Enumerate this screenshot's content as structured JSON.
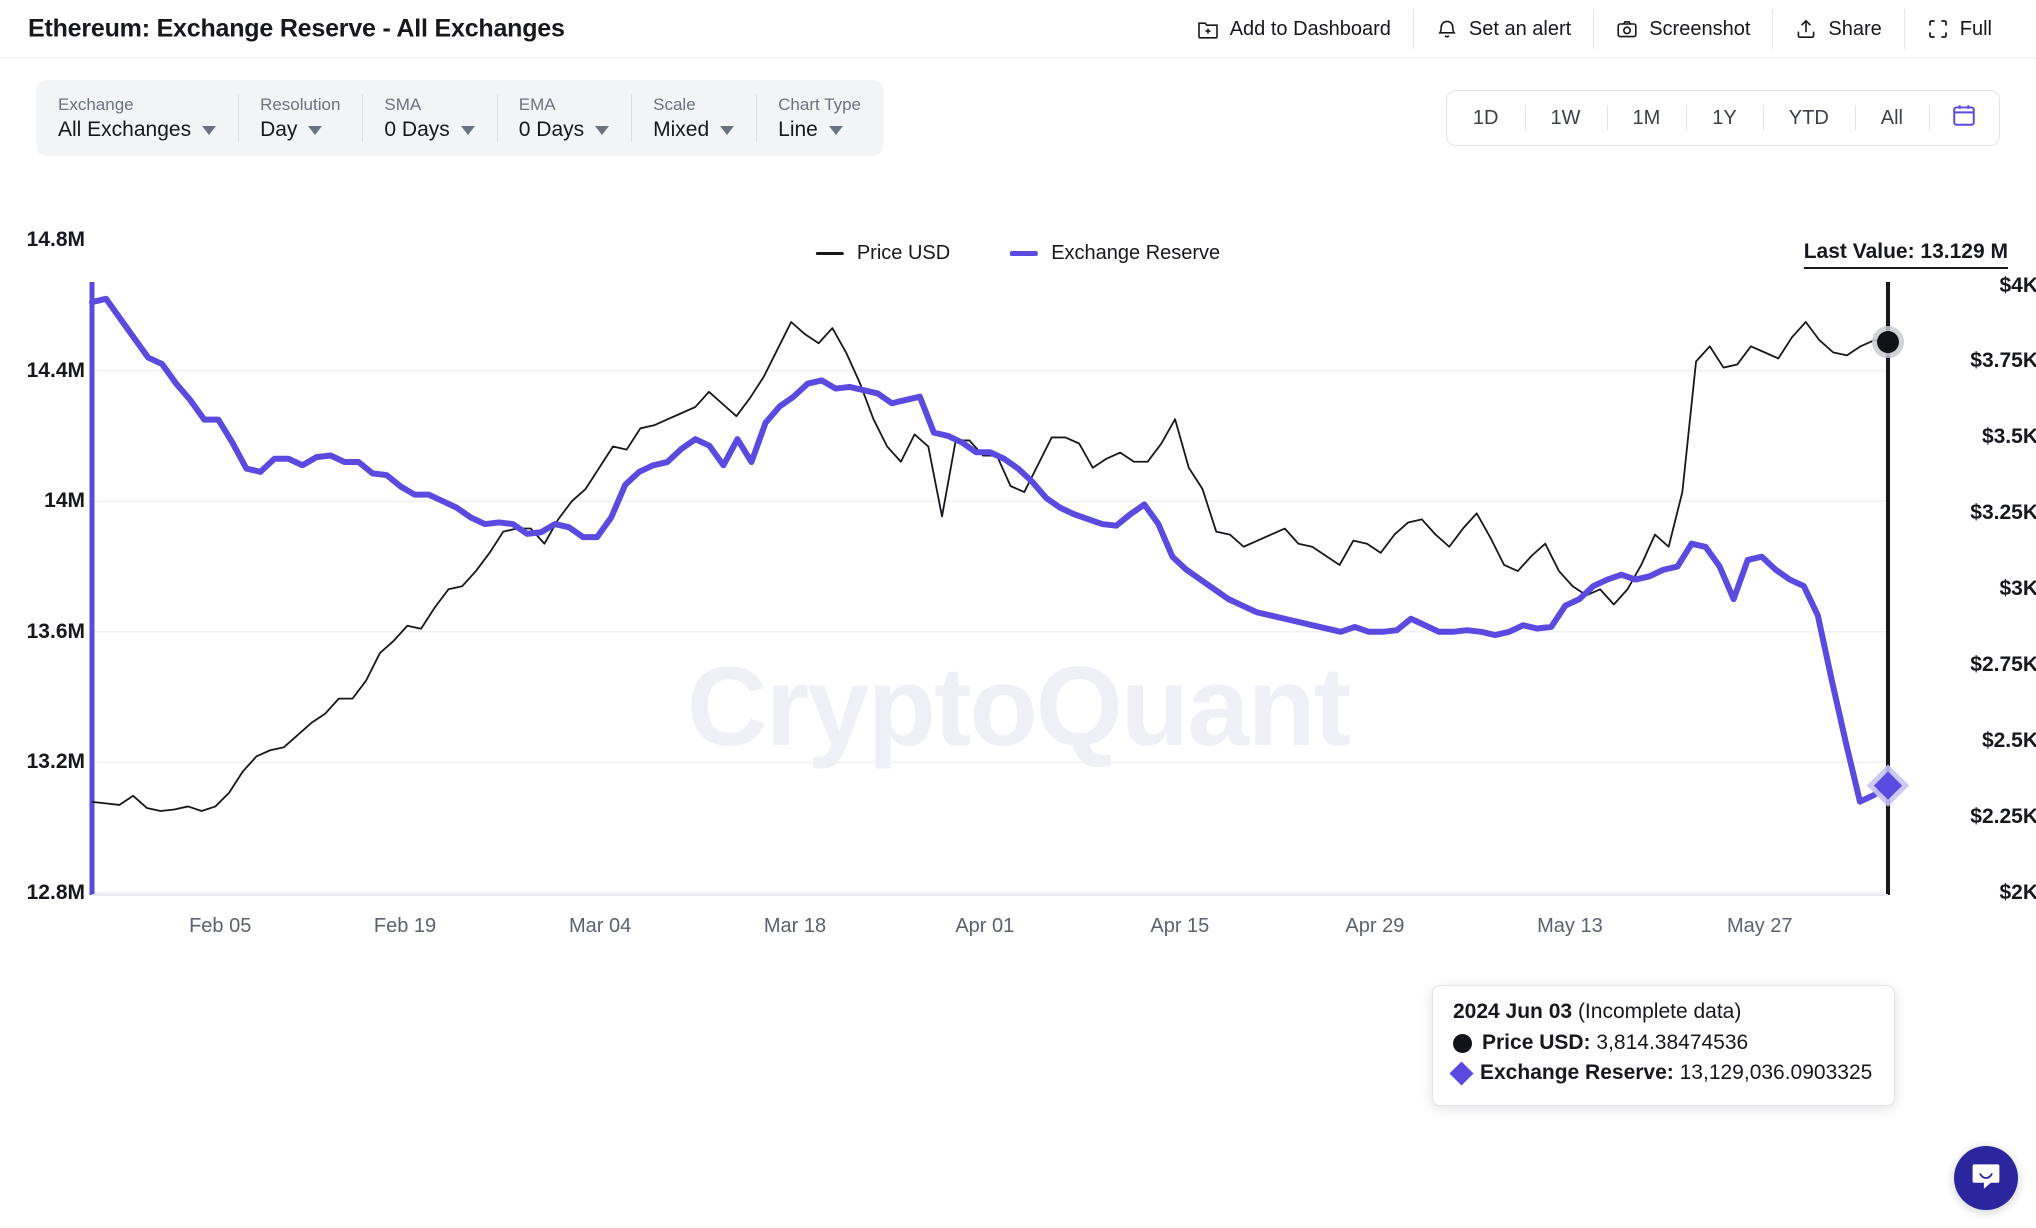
{
  "header": {
    "title": "Ethereum: Exchange Reserve - All Exchanges",
    "actions": [
      {
        "icon": "add-to-dashboard-icon",
        "label": "Add to Dashboard"
      },
      {
        "icon": "bell-icon",
        "label": "Set an alert"
      },
      {
        "icon": "camera-icon",
        "label": "Screenshot"
      },
      {
        "icon": "share-icon",
        "label": "Share"
      },
      {
        "icon": "fullscreen-icon",
        "label": "Full"
      }
    ]
  },
  "controls": [
    {
      "name": "exchange",
      "label": "Exchange",
      "value": "All Exchanges"
    },
    {
      "name": "resolution",
      "label": "Resolution",
      "value": "Day"
    },
    {
      "name": "sma",
      "label": "SMA",
      "value": "0 Days"
    },
    {
      "name": "ema",
      "label": "EMA",
      "value": "0 Days"
    },
    {
      "name": "scale",
      "label": "Scale",
      "value": "Mixed"
    },
    {
      "name": "chart-type",
      "label": "Chart Type",
      "value": "Line"
    }
  ],
  "ranges": [
    "1D",
    "1W",
    "1M",
    "1Y",
    "YTD",
    "All"
  ],
  "calendar_icon": "calendar-icon",
  "legend": [
    {
      "label": "Price USD",
      "color": "#16181d"
    },
    {
      "label": "Exchange Reserve",
      "color": "#5b4ae0"
    }
  ],
  "last_value": "Last Value: 13.129 M",
  "watermark": "CryptoQuant",
  "tooltip": {
    "date": "2024 Jun 03",
    "note": "(Incomplete data)",
    "rows": [
      {
        "marker": "circle",
        "name": "Price USD",
        "value": "3,814.38474536"
      },
      {
        "marker": "diamond",
        "name": "Exchange Reserve",
        "value": "13,129,036.0903325"
      }
    ]
  },
  "chat": {
    "icon": "chat-icon"
  },
  "chart_data": {
    "type": "line",
    "title": "Ethereum: Exchange Reserve - All Exchanges",
    "xlabel": "",
    "ylabel": "Exchange Reserve",
    "y2label": "Price USD",
    "grid": true,
    "legend_position": "top-center",
    "x_tick_labels": [
      "Feb 05",
      "Feb 19",
      "Mar 04",
      "Mar 18",
      "Apr 01",
      "Apr 15",
      "Apr 29",
      "May 13",
      "May 27"
    ],
    "x_tick_positions": [
      0.0714,
      0.1743,
      0.2829,
      0.3914,
      0.4971,
      0.6057,
      0.7143,
      0.8229,
      0.9286
    ],
    "y_left_ticks": [
      "12.8M",
      "13.2M",
      "13.6M",
      "14M",
      "14.4M",
      "14.8M"
    ],
    "y_left_values": [
      12800000,
      13200000,
      13600000,
      14000000,
      14400000,
      14800000
    ],
    "ylim": [
      12800000,
      14800000
    ],
    "y_right_ticks": [
      "$2.25K",
      "$2.5K",
      "$2.75K",
      "$3K",
      "$3.25K",
      "$3.5K",
      "$3.75K",
      "$4K"
    ],
    "y_right_values": [
      2250,
      2500,
      2750,
      3000,
      3250,
      3500,
      3750,
      4000
    ],
    "y2lim": [
      2000,
      4150
    ],
    "series": [
      {
        "name": "Exchange Reserve",
        "color": "#5b4ae0",
        "axis": "left",
        "unit": "ETH",
        "values": [
          14610000,
          14620000,
          14560000,
          14500000,
          14440000,
          14420000,
          14360000,
          14310000,
          14250000,
          14250000,
          14180000,
          14100000,
          14090000,
          14130000,
          14130000,
          14110000,
          14135000,
          14140000,
          14120000,
          14120000,
          14085000,
          14080000,
          14045000,
          14020000,
          14020000,
          14000000,
          13980000,
          13950000,
          13930000,
          13935000,
          13930000,
          13900000,
          13905000,
          13930000,
          13920000,
          13890000,
          13890000,
          13950000,
          14050000,
          14090000,
          14110000,
          14120000,
          14160000,
          14190000,
          14170000,
          14110000,
          14190000,
          14120000,
          14240000,
          14290000,
          14320000,
          14360000,
          14370000,
          14345000,
          14350000,
          14340000,
          14330000,
          14300000,
          14310000,
          14320000,
          14210000,
          14200000,
          14180000,
          14150000,
          14150000,
          14130000,
          14100000,
          14060000,
          14010000,
          13980000,
          13960000,
          13945000,
          13930000,
          13925000,
          13960000,
          13990000,
          13930000,
          13830000,
          13790000,
          13760000,
          13730000,
          13700000,
          13680000,
          13660000,
          13650000,
          13640000,
          13630000,
          13620000,
          13610000,
          13600000,
          13615000,
          13600000,
          13600000,
          13605000,
          13640000,
          13620000,
          13600000,
          13600000,
          13605000,
          13600000,
          13590000,
          13600000,
          13620000,
          13610000,
          13615000,
          13680000,
          13700000,
          13740000,
          13760000,
          13775000,
          13760000,
          13770000,
          13790000,
          13800000,
          13870000,
          13860000,
          13800000,
          13700000,
          13820000,
          13830000,
          13790000,
          13760000,
          13740000,
          13650000,
          13450000,
          13260000,
          13080000,
          13100000,
          13129036
        ]
      },
      {
        "name": "Price USD",
        "color": "#16181d",
        "axis": "right",
        "unit": "USD",
        "values": [
          2300,
          2295,
          2290,
          2320,
          2280,
          2270,
          2275,
          2285,
          2270,
          2285,
          2330,
          2400,
          2450,
          2470,
          2480,
          2520,
          2560,
          2590,
          2640,
          2640,
          2700,
          2790,
          2830,
          2880,
          2870,
          2940,
          3000,
          3010,
          3060,
          3120,
          3190,
          3200,
          3200,
          3150,
          3230,
          3290,
          3330,
          3400,
          3470,
          3460,
          3530,
          3540,
          3560,
          3580,
          3600,
          3650,
          3610,
          3570,
          3630,
          3700,
          3790,
          3880,
          3840,
          3810,
          3860,
          3780,
          3680,
          3560,
          3470,
          3420,
          3510,
          3470,
          3240,
          3490,
          3490,
          3440,
          3440,
          3340,
          3320,
          3410,
          3500,
          3500,
          3480,
          3400,
          3430,
          3450,
          3420,
          3420,
          3480,
          3560,
          3400,
          3330,
          3190,
          3180,
          3140,
          3160,
          3180,
          3200,
          3150,
          3140,
          3110,
          3080,
          3160,
          3150,
          3120,
          3180,
          3220,
          3230,
          3180,
          3140,
          3200,
          3250,
          3170,
          3080,
          3060,
          3110,
          3150,
          3060,
          3010,
          2980,
          3000,
          2950,
          3000,
          3080,
          3180,
          3140,
          3320,
          3750,
          3800,
          3730,
          3740,
          3800,
          3780,
          3760,
          3830,
          3880,
          3820,
          3780,
          3770,
          3800,
          3820,
          3814
        ]
      }
    ],
    "markers": {
      "price_end": {
        "value": 3814.38474536,
        "shape": "circle",
        "color": "#111316"
      },
      "reserve_end": {
        "value": 13129036.0903325,
        "shape": "diamond",
        "color": "#5b4ae0"
      }
    },
    "annotations": [
      {
        "type": "axis-line-left",
        "color": "#5b4ae0"
      },
      {
        "type": "axis-line-right",
        "color": "#16181d"
      }
    ]
  }
}
